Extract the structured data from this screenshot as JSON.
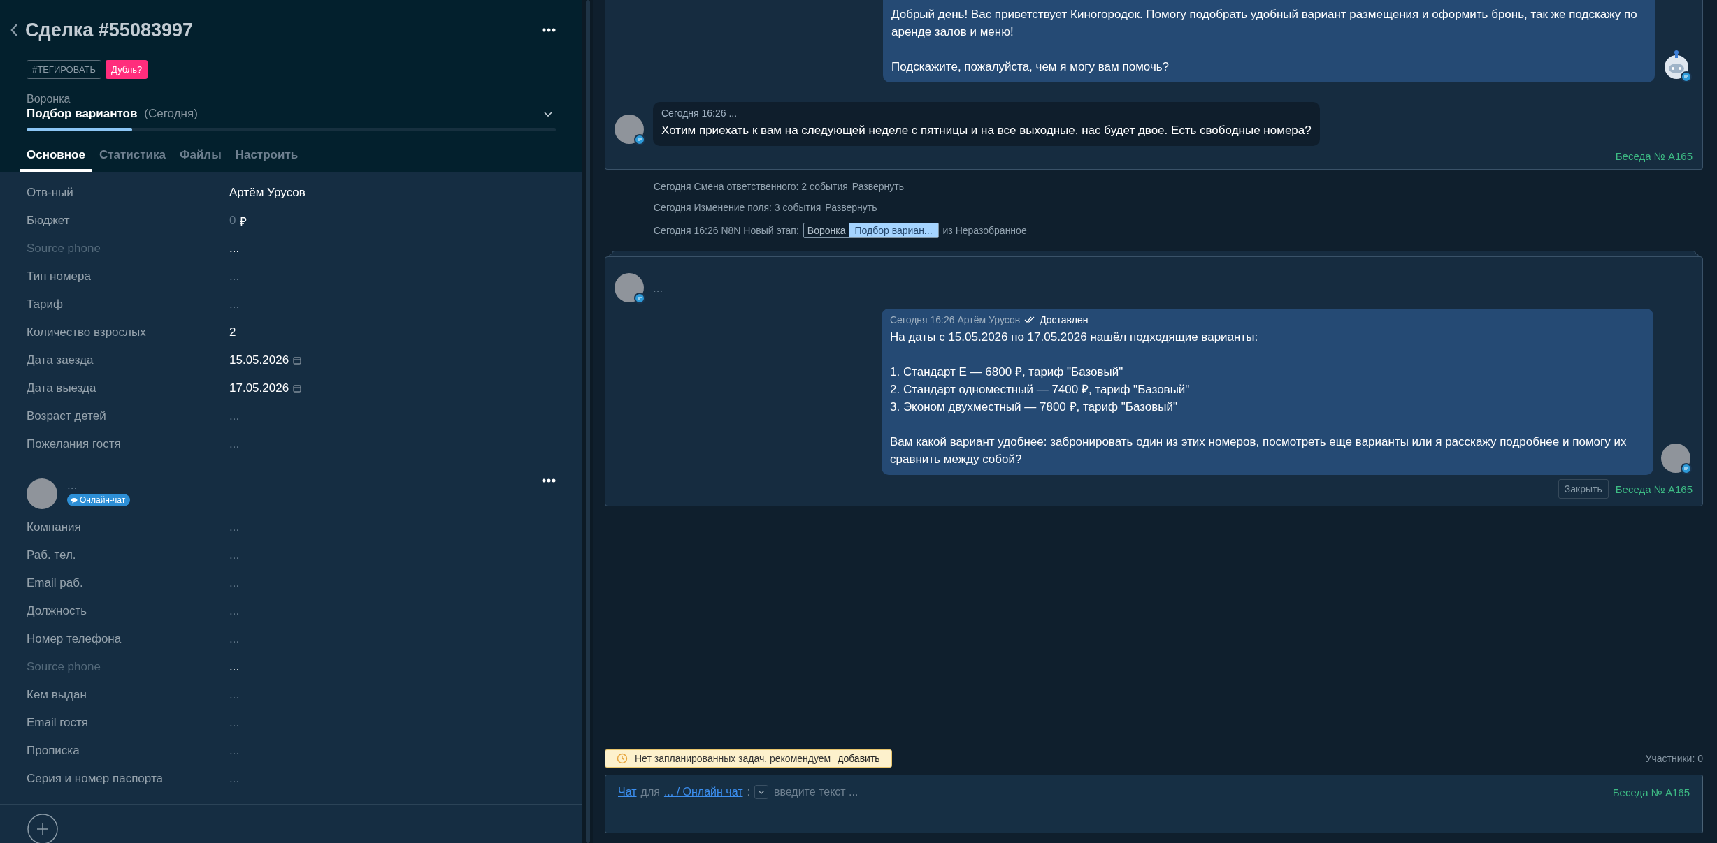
{
  "deal": {
    "title": "Сделка #55083997",
    "tags": [
      {
        "label": "#ТЕГИРОВАТЬ",
        "kind": "outline"
      },
      {
        "label": "Дубль?",
        "kind": "alert"
      }
    ],
    "pipeline": {
      "label": "Воронка",
      "stage": "Подбор вариантов",
      "when": "(Сегодня)",
      "level": 0.2
    },
    "tabs": [
      {
        "label": "Основное",
        "selected": true
      },
      {
        "label": "Статистика",
        "selected": false
      },
      {
        "label": "Файлы",
        "selected": false
      },
      {
        "label": "Настроить",
        "selected": false
      }
    ],
    "fields": [
      {
        "label": "Отв-ный",
        "value": "Артём Урусов",
        "kind": "text",
        "dim_label": false,
        "dim_value": false
      },
      {
        "label": "Бюджет",
        "value": "0",
        "currency": "₽",
        "kind": "money",
        "dim_label": false,
        "dim_value": true
      },
      {
        "label": "Source phone",
        "value": "...",
        "kind": "text",
        "dim_label": true,
        "dim_value": false
      },
      {
        "label": "Тип номера",
        "value": "...",
        "kind": "text",
        "dim_label": false,
        "dim_value": true
      },
      {
        "label": "Тариф",
        "value": "...",
        "kind": "text",
        "dim_label": false,
        "dim_value": true
      },
      {
        "label": "Количество взрослых",
        "value": "2",
        "kind": "text",
        "dim_label": false,
        "dim_value": false
      },
      {
        "label": "Дата заезда",
        "value": "15.05.2026",
        "kind": "date",
        "dim_label": false,
        "dim_value": false
      },
      {
        "label": "Дата выезда",
        "value": "17.05.2026",
        "kind": "date",
        "dim_label": false,
        "dim_value": false
      },
      {
        "label": "Возраст детей",
        "value": "...",
        "kind": "text",
        "dim_label": false,
        "dim_value": true
      },
      {
        "label": "Пожелания гостя",
        "value": "...",
        "kind": "text",
        "dim_label": false,
        "dim_value": true
      }
    ]
  },
  "contact": {
    "name": "...",
    "badge": "Онлайн-чат",
    "fields": [
      {
        "label": "Компания",
        "value": "...",
        "dim_label": false,
        "dim_value": true
      },
      {
        "label": "Раб. тел.",
        "value": "...",
        "dim_label": false,
        "dim_value": true
      },
      {
        "label": "Email раб.",
        "value": "...",
        "dim_label": false,
        "dim_value": true
      },
      {
        "label": "Должность",
        "value": "...",
        "dim_label": false,
        "dim_value": true
      },
      {
        "label": "Номер телефона",
        "value": "...",
        "dim_label": false,
        "dim_value": true
      },
      {
        "label": "Source phone",
        "value": "...",
        "dim_label": true,
        "dim_value": false
      },
      {
        "label": "Кем выдан",
        "value": "...",
        "dim_label": false,
        "dim_value": true
      },
      {
        "label": "Email гостя",
        "value": "...",
        "dim_label": false,
        "dim_value": true
      },
      {
        "label": "Прописка",
        "value": "...",
        "dim_label": false,
        "dim_value": true
      },
      {
        "label": "Серия и номер паспорта",
        "value": "...",
        "dim_label": false,
        "dim_value": true
      }
    ]
  },
  "feed": {
    "card_1": {
      "messages": [
        {
          "kind": "outgoing",
          "bot": true,
          "text": "Добрый день! Вас приветствует Киногородок. Помогу подобрать удобный вариант размещения и оформить бронь, так же подскажу по аренде залов и меню!\n\nПодскажите, пожалуйста, чем я могу вам помочь?"
        },
        {
          "kind": "incoming",
          "bot": false,
          "meta": "Сегодня 16:26 ...",
          "text": "Хотим приехать к вам на следующей неделе с пятницы и на все выходные, нас будет двое. Есть свободные номера?"
        }
      ],
      "footer": "Беседа № А165"
    },
    "events": [
      {
        "kind": "text",
        "text": "Сегодня Смена ответственного: 2 события",
        "link": "Развернуть"
      },
      {
        "kind": "text",
        "text": "Сегодня Изменение поля: 3 события",
        "link": "Развернуть"
      },
      {
        "kind": "stage",
        "text": "Сегодня 16:26 N8N Новый этап:",
        "pipeline": "Воронка",
        "stage": "Подбор вариан...",
        "suffix": "из Неразобранное"
      }
    ],
    "card_2": {
      "sender": "...",
      "messages": [
        {
          "kind": "outgoing",
          "bot": false,
          "meta": "Сегодня 16:26 Артём Урусов",
          "status": "Доставлен",
          "text": "На даты с 15.05.2026 по 17.05.2026 нашёл подходящие варианты:\n\n1. Стандарт Е — 6800 ₽, тариф \"Базовый\"\n2. Стандарт одноместный — 7400 ₽, тариф \"Базовый\"\n3. Эконом двухместный — 7800 ₽, тариф \"Базовый\"\n\nВам какой вариант удобнее: забронировать один из этих номеров, посмотреть еще варианты или я расскажу подробнее и помогу их сравнить между собой?"
        }
      ],
      "close": "Закрыть",
      "footer": "Беседа № А165"
    }
  },
  "tasks": {
    "text": "Нет запланированных задач, рекомендуем",
    "link": "добавить",
    "participants": "Участники: 0"
  },
  "composer": {
    "chat": "Чат",
    "for": "для",
    "target": "... / Онлайн чат",
    "colon": ":",
    "placeholder": "введите текст ...",
    "footer": "Беседа № А165"
  }
}
